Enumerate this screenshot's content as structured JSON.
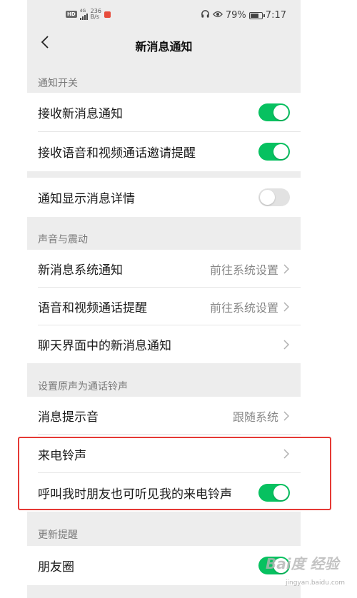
{
  "status_bar": {
    "hd": "HD",
    "network": "4G",
    "speed_value": "236",
    "speed_unit": "B/s",
    "battery": "79%",
    "time": "7:17",
    "battery_level": 0.79
  },
  "nav": {
    "title": "新消息通知"
  },
  "sections": {
    "notify_switch": {
      "header": "通知开关"
    },
    "sound_vibration": {
      "header": "声音与震动"
    },
    "ringtone": {
      "header": "设置原声为通话铃声"
    },
    "update": {
      "header": "更新提醒"
    }
  },
  "rows": {
    "receive_new": {
      "label": "接收新消息通知",
      "toggle": true
    },
    "receive_call_invite": {
      "label": "接收语音和视频通话邀请提醒",
      "toggle": true
    },
    "show_details": {
      "label": "通知显示消息详情",
      "toggle": false
    },
    "system_notify": {
      "label": "新消息系统通知",
      "value": "前往系统设置"
    },
    "call_reminder": {
      "label": "语音和视频通话提醒",
      "value": "前往系统设置"
    },
    "chat_notify": {
      "label": "聊天界面中的新消息通知"
    },
    "msg_sound": {
      "label": "消息提示音",
      "value": "跟随系统"
    },
    "incoming_ringtone": {
      "label": "来电铃声"
    },
    "friends_hear_ringtone": {
      "label": "呼叫我时朋友也可听见我的来电铃声",
      "toggle": true
    },
    "moments": {
      "label": "朋友圈",
      "toggle": true
    }
  },
  "watermark": {
    "text": "Bai度 经验",
    "sub": "jingyan.baidu.com"
  },
  "colors": {
    "toggle_on": "#07c160",
    "toggle_off": "#e2e2e2",
    "highlight": "#e53935",
    "background": "#ededed"
  },
  "icons": {
    "back": "chevron-left-icon",
    "row_arrow": "chevron-right-icon",
    "headset": "headset-icon",
    "eye": "eye-icon",
    "battery": "battery-icon",
    "signal": "signal-icon"
  }
}
